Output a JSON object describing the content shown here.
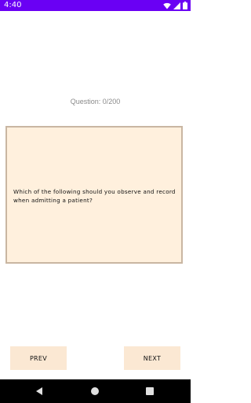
{
  "status_bar": {
    "time": "4:40",
    "icons": [
      "wifi-icon",
      "signal-icon",
      "battery-icon"
    ],
    "background": "#6a00f4"
  },
  "quiz": {
    "counter": "Question: 0/200",
    "question": "Which of the following should you observe and record when admitting a patient?",
    "card_background": "#fff0dd",
    "card_border": "#c9b6a2"
  },
  "buttons": {
    "prev_label": "PREV",
    "next_label": "NEXT",
    "background": "#fbe8d3"
  },
  "system_nav": {
    "icons": [
      "back-icon",
      "home-icon",
      "recents-icon"
    ]
  }
}
